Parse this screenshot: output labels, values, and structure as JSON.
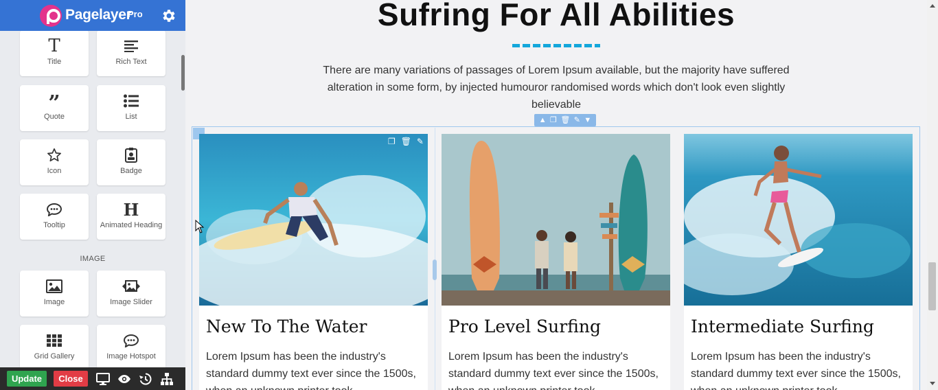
{
  "brand": {
    "name": "Pagelayer",
    "tier": "Pro"
  },
  "sidebar": {
    "widgets": [
      {
        "label": "Title",
        "icon": "title-icon"
      },
      {
        "label": "Rich Text",
        "icon": "rich-text-icon"
      },
      {
        "label": "Quote",
        "icon": "quote-icon"
      },
      {
        "label": "List",
        "icon": "list-icon"
      },
      {
        "label": "Icon",
        "icon": "star-icon"
      },
      {
        "label": "Badge",
        "icon": "badge-icon"
      },
      {
        "label": "Tooltip",
        "icon": "tooltip-icon"
      },
      {
        "label": "Animated Heading",
        "icon": "animated-heading-icon"
      }
    ],
    "image_section_title": "IMAGE",
    "image_widgets": [
      {
        "label": "Image",
        "icon": "image-icon"
      },
      {
        "label": "Image Slider",
        "icon": "image-slider-icon"
      },
      {
        "label": "Grid Gallery",
        "icon": "grid-gallery-icon"
      },
      {
        "label": "Image Hotspot",
        "icon": "image-hotspot-icon"
      }
    ]
  },
  "footer": {
    "update_label": "Update",
    "close_label": "Close"
  },
  "page": {
    "heading": "Sufring For All Abilities",
    "intro": "There are many variations of passages of Lorem Ipsum available, but the majority have suffered alteration in some form, by injected humouror randomised words which don't look even slightly believable",
    "cards": [
      {
        "title": "New To The Water",
        "text": "Lorem Ipsum has been the industry's standard dummy text ever since the 1500s, when an unknown printer took"
      },
      {
        "title": "Pro Level Surfing",
        "text": "Lorem Ipsum has been the industry's standard dummy text ever since the 1500s, when an unknown printer took"
      },
      {
        "title": "Intermediate Surfing",
        "text": "Lorem Ipsum has been the industry's standard dummy text ever since the 1500s, when an unknown printer took"
      }
    ]
  },
  "colors": {
    "header_blue": "#3573d4",
    "accent_cyan": "#14a7db",
    "update_green": "#2fa44f",
    "close_red": "#e23c45",
    "logo_pink": "#e3338c"
  }
}
